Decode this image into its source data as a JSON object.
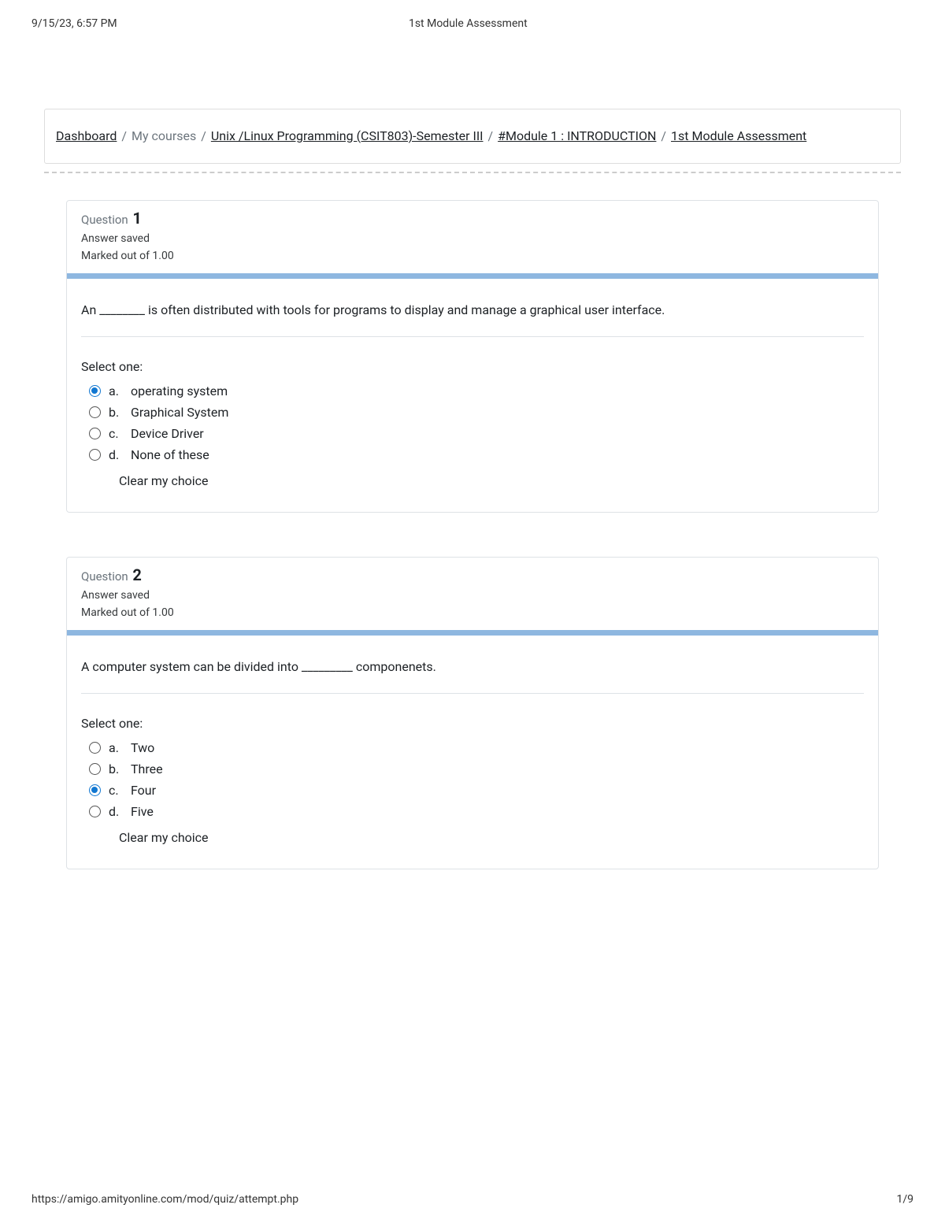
{
  "header": {
    "timestamp": "9/15/23, 6:57 PM",
    "title": "1st Module Assessment"
  },
  "breadcrumb": {
    "items": [
      {
        "label": "Dashboard",
        "link": true
      },
      {
        "label": "My courses",
        "link": false
      },
      {
        "label": "Unix /Linux Programming (CSIT803)-Semester III",
        "link": true
      },
      {
        "label": "#Module 1 : INTRODUCTION",
        "link": true
      },
      {
        "label": "1st Module Assessment",
        "link": true
      }
    ]
  },
  "labels": {
    "question_prefix": "Question",
    "select_one": "Select one:",
    "clear_choice": "Clear my choice"
  },
  "questions": [
    {
      "number": "1",
      "state": "Answer saved",
      "grade": "Marked out of 1.00",
      "text": "An ________ is often distributed with tools for programs to display and manage a graphical user interface.",
      "selected": 0,
      "options": [
        {
          "letter": "a.",
          "label": "operating system"
        },
        {
          "letter": "b.",
          "label": "Graphical System"
        },
        {
          "letter": "c.",
          "label": "Device Driver"
        },
        {
          "letter": "d.",
          "label": "None of these"
        }
      ]
    },
    {
      "number": "2",
      "state": "Answer saved",
      "grade": "Marked out of 1.00",
      "text": "A computer system can be divided into _________ componenets.",
      "selected": 2,
      "options": [
        {
          "letter": "a.",
          "label": "Two"
        },
        {
          "letter": "b.",
          "label": "Three"
        },
        {
          "letter": "c.",
          "label": "Four"
        },
        {
          "letter": "d.",
          "label": "Five"
        }
      ]
    }
  ],
  "footer": {
    "url": "https://amigo.amityonline.com/mod/quiz/attempt.php",
    "page": "1/9"
  }
}
